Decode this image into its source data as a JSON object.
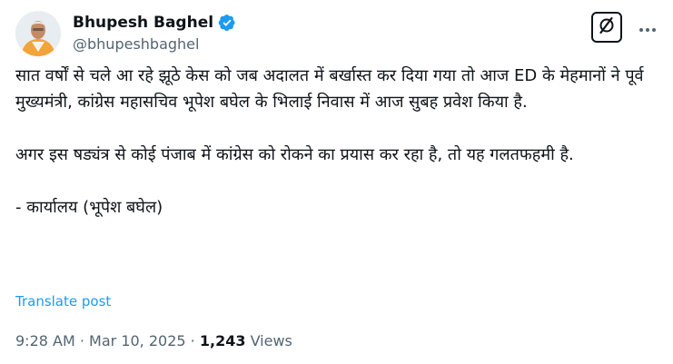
{
  "author": {
    "display_name": "Bhupesh Baghel",
    "handle": "@bhupeshbaghel",
    "verified": true,
    "verified_color": "#1d9bf0"
  },
  "icons": {
    "grok": "grok-icon",
    "more": "more-horizontal-icon",
    "verified": "verified-badge-icon"
  },
  "post": {
    "paragraphs": [
      "सात वर्षों से चले आ रहे झूठे केस को जब अदालत में बर्खास्त कर दिया गया तो आज ED के मेहमानों ने पूर्व मुख्यमंत्री, कांग्रेस महासचिव भूपेश बघेल के भिलाई निवास में आज सुबह प्रवेश किया है.",
      "अगर इस षड्यंत्र से कोई पंजाब में कांग्रेस को रोकने का प्रयास कर रहा है, तो यह गलतफहमी है.",
      "- कार्यालय (भूपेश बघेल)"
    ],
    "translate_label": "Translate post"
  },
  "meta": {
    "time": "9:28 AM",
    "separator": "·",
    "date": "Mar 10, 2025",
    "views_count": "1,243",
    "views_label": "Views"
  },
  "colors": {
    "text": "#0f1419",
    "muted": "#536471",
    "link": "#1d9bf0"
  }
}
